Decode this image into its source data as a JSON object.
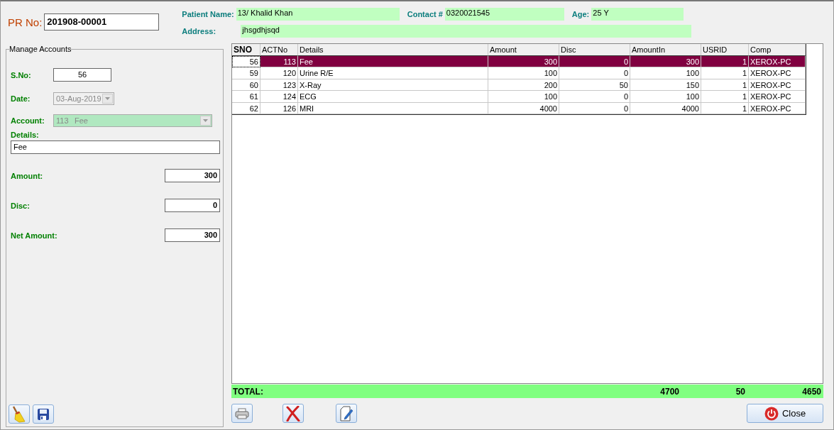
{
  "pr_no": {
    "label": "PR No:",
    "value": "201908-00001"
  },
  "patient": {
    "fields": [
      {
        "label": "Patient Name:",
        "value": "13/ Khalid Khan"
      },
      {
        "label": "Contact #",
        "value": "0320021545"
      },
      {
        "label": "Age:",
        "value": "25 Y"
      }
    ],
    "address": {
      "label": "Address:",
      "value": "jhsgdhjsqd"
    }
  },
  "manage_accounts": {
    "title": "Manage Accounts",
    "sno": {
      "label": "S.No:",
      "value": "56"
    },
    "date": {
      "label": "Date:",
      "value": "03-Aug-2019",
      "disabled": true
    },
    "account": {
      "label": "Account:",
      "code": "113",
      "name": "Fee",
      "disabled": true
    },
    "details": {
      "label": "Details:",
      "value": "Fee"
    },
    "amounts": [
      {
        "label": "Amount:",
        "value": "300"
      },
      {
        "label": "Disc:",
        "value": "0"
      },
      {
        "label": "Net Amount:",
        "value": "300"
      }
    ]
  },
  "table": {
    "columns": [
      "SNO",
      "ACTNo",
      "Details",
      "Amount",
      "Disc",
      "AmountIn",
      "USRID",
      "Comp"
    ],
    "rows": [
      {
        "cells": [
          "56",
          "113",
          "Fee",
          "300",
          "0",
          "300",
          "1",
          "XEROX-PC"
        ],
        "selected": true
      },
      {
        "cells": [
          "59",
          "120",
          "Urine R/E",
          "100",
          "0",
          "100",
          "1",
          "XEROX-PC"
        ],
        "selected": false
      },
      {
        "cells": [
          "60",
          "123",
          "X-Ray",
          "200",
          "50",
          "150",
          "1",
          "XEROX-PC"
        ],
        "selected": false
      },
      {
        "cells": [
          "61",
          "124",
          "ECG",
          "100",
          "0",
          "100",
          "1",
          "XEROX-PC"
        ],
        "selected": false
      },
      {
        "cells": [
          "62",
          "126",
          "MRI",
          "4000",
          "0",
          "4000",
          "1",
          "XEROX-PC"
        ],
        "selected": false
      }
    ]
  },
  "totals": {
    "label": "TOTAL:",
    "amount": "4700",
    "disc": "50",
    "amount_in": "4650"
  },
  "close_button": {
    "label": "Close"
  }
}
